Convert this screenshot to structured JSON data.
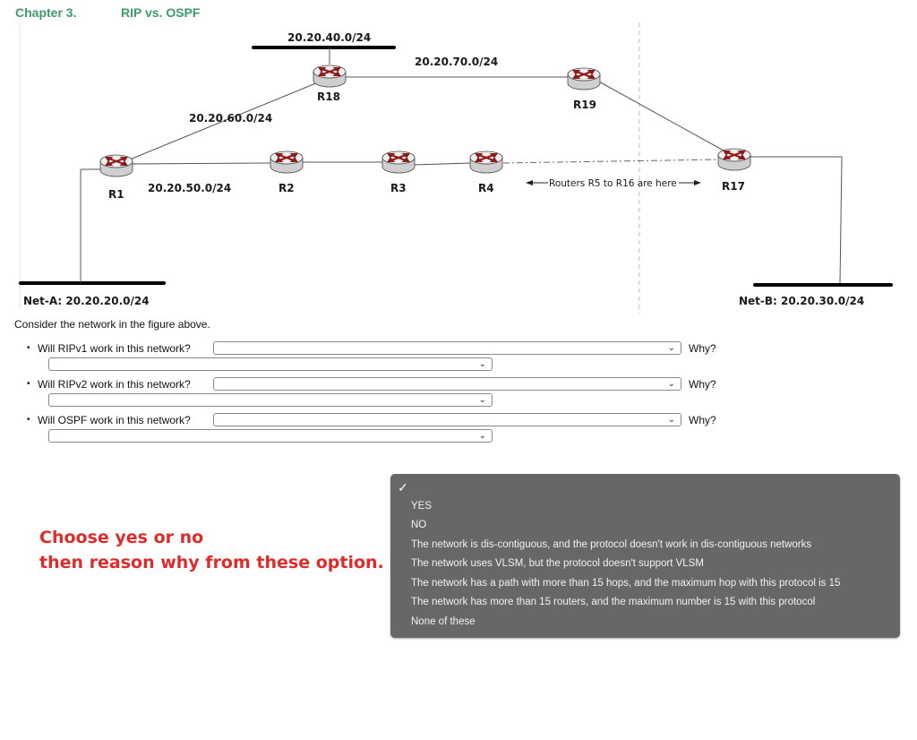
{
  "header": {
    "chapter": "Chapter  3.",
    "title": "RIP vs. OSPF"
  },
  "diagram": {
    "networks": {
      "n40": "20.20.40.0/24",
      "n70": "20.20.70.0/24",
      "n60": "20.20.60.0/24",
      "n50": "20.20.50.0/24",
      "netA": "Net-A: 20.20.20.0/24",
      "netB": "Net-B: 20.20.30.0/24"
    },
    "routers": {
      "r1": "R1",
      "r2": "R2",
      "r3": "R3",
      "r4": "R4",
      "r17": "R17",
      "r18": "R18",
      "r19": "R19"
    },
    "hidden_routers_note": "Routers R5 to R16 are here",
    "colors": {
      "router_arrow": "#8b1a1a",
      "router_body": "#d8d8d8",
      "link": "#555555",
      "lan": "#000000"
    }
  },
  "intro": "Consider the network in the figure above.",
  "questions": [
    {
      "label": "Will RIPv1 work in this network?",
      "answer": "",
      "why_label": "Why?",
      "reason": ""
    },
    {
      "label": "Will RIPv2 work in this network?",
      "answer": "",
      "why_label": "Why?",
      "reason": ""
    },
    {
      "label": "Will OSPF work in this network?",
      "answer": "",
      "why_label": "Why?",
      "reason": ""
    }
  ],
  "note": {
    "line1": "Choose yes or no",
    "line2": "then reason why from these option.",
    "color": "#e02b2b"
  },
  "dropdown_menu": {
    "selected_check": "✓",
    "options": [
      "YES",
      "NO",
      "The network is dis-contiguous, and the protocol doesn't work in dis-contiguous networks",
      "The network uses VLSM, but the protocol doesn't support VLSM",
      "The network has a path with more than 15 hops, and the maximum hop with this protocol is 15",
      "The network has more than 15 routers, and the maximum number is 15 with this protocol",
      "None of these"
    ]
  }
}
